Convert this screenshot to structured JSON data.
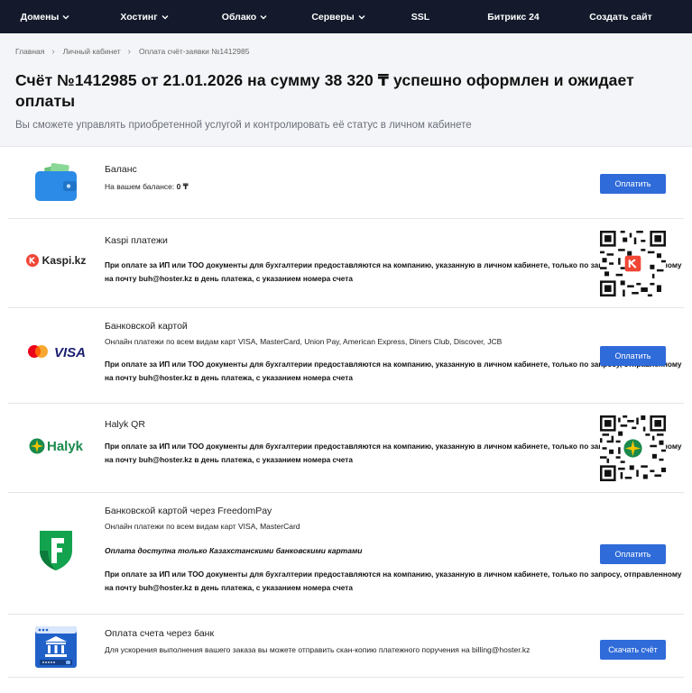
{
  "nav": {
    "items": [
      {
        "label": "Домены",
        "dropdown": true
      },
      {
        "label": "Хостинг",
        "dropdown": true
      },
      {
        "label": "Облако",
        "dropdown": true
      },
      {
        "label": "Серверы",
        "dropdown": true
      },
      {
        "label": "SSL",
        "dropdown": false
      },
      {
        "label": "Битрикс 24",
        "dropdown": false
      },
      {
        "label": "Создать сайт",
        "dropdown": false
      }
    ]
  },
  "breadcrumb": [
    "Главная",
    "Личный кабинет",
    "Оплата счёт-заявки №1412985"
  ],
  "title": "Счёт №1412985 от 21.01.2026 на сумму 38 320 ₸ успешно оформлен и ожидает оплаты",
  "subtitle": "Вы сможете управлять приобретенной услугой и контролировать её статус в личном кабинете",
  "legal_note": "При оплате за ИП или ТОО документы для бухгалтерии предоставляются на компанию, указанную в личном кабинете, только по запросу, отправленному на почту buh@hoster.kz в день платежа, с указанием номера счета",
  "methods": {
    "balance": {
      "name": "Баланс",
      "desc": "На вашем балансе:",
      "amount": "0 ₸",
      "button": "Оплатить"
    },
    "kaspi": {
      "name": "Kaspi платежи",
      "logo_text": "Kaspi.kz"
    },
    "card": {
      "name": "Банковской картой",
      "desc": "Онлайн платежи по всем видам карт VISA, MasterCard, Union Pay, American Express, Diners Club, Discover, JCB",
      "button": "Оплатить",
      "logo_text": "VISA"
    },
    "halyk": {
      "name": "Halyk QR",
      "logo_text": "Halyk"
    },
    "freedom": {
      "name": "Банковской картой через FreedomPay",
      "desc": "Онлайн платежи по всем видам карт VISA, MasterCard",
      "note": "Оплата доступна только Казахстанскими банковскими картами",
      "button": "Оплатить"
    },
    "bank": {
      "name": "Оплата счета через банк",
      "desc": "Для ускорения выполнения вашего заказа вы можете отправить скан-копию платежного поручения на billing@hoster.kz",
      "button": "Скачать счёт"
    }
  },
  "colors": {
    "nav_bg": "#141a2c",
    "accent": "#2f6bd9",
    "header_bg": "#f4f5f8",
    "kaspi_red": "#f14635",
    "halyk_green": "#1a8a4c",
    "freedom_green": "#13a34f"
  }
}
